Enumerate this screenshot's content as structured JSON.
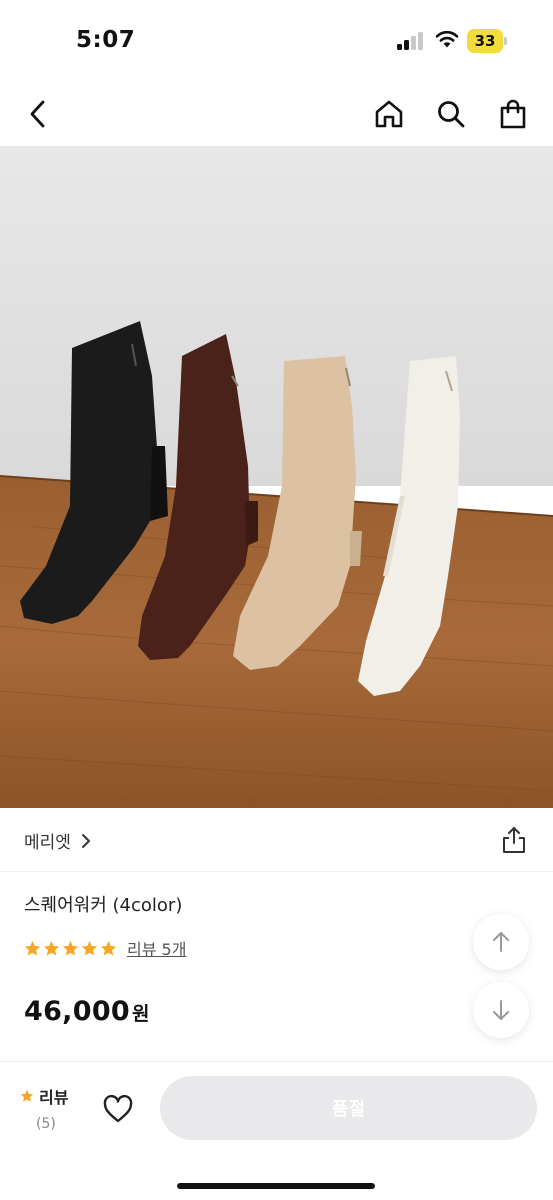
{
  "status_bar": {
    "time": "5:07",
    "battery": "33",
    "battery_color": "#f2dc3b"
  },
  "nav": {
    "back_icon": "chevron-left-icon",
    "home_icon": "home-icon",
    "search_icon": "search-icon",
    "cart_icon": "shopping-bag-icon"
  },
  "product_image": {
    "colors": [
      "#1b1b1b",
      "#4a2219",
      "#dcc1a2",
      "#f2efe8"
    ]
  },
  "brand": {
    "name": "메리엣",
    "share_icon": "share-icon"
  },
  "product": {
    "title": "스퀘어워커 (4color)",
    "rating_stars": 5,
    "review_link": "리뷰 5개",
    "price": "46,000",
    "currency": "원",
    "star_color": "#f5a623"
  },
  "scroll": {
    "up_icon": "arrow-up-icon",
    "down_icon": "arrow-down-icon"
  },
  "bottom_bar": {
    "review_label": "리뷰",
    "review_count": "(5)",
    "wish_icon": "heart-icon",
    "soldout_label": "품절"
  }
}
